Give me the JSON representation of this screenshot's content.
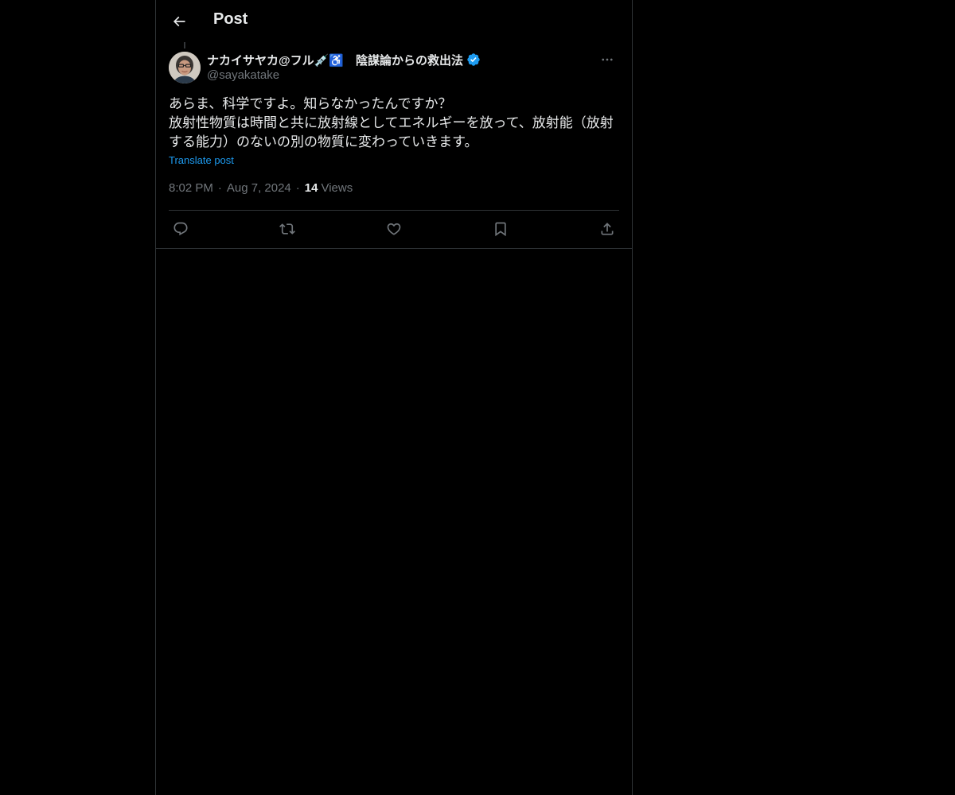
{
  "header": {
    "title": "Post"
  },
  "tweet": {
    "author": {
      "display_name": "ナカイサヤカ@フル💉♿️　陰謀論からの救出法",
      "handle": "@sayakatake",
      "verified": true
    },
    "text": "あらま、科学ですよ。知らなかったんですか？\n放射性物質は時間と共に放射線としてエネルギーを放って、放射能（放射する能力）のないの別の物質に変わっていきます。",
    "translate_label": "Translate post",
    "time": "8:02 PM",
    "date": "Aug 7, 2024",
    "views_count": "14",
    "views_label": "Views",
    "separator": "·"
  },
  "icons": {
    "back": "arrow-left-icon",
    "more": "more-horizontal-icon",
    "reply": "reply-icon",
    "repost": "repost-icon",
    "like": "heart-icon",
    "bookmark": "bookmark-icon",
    "share": "share-icon",
    "verified": "verified-badge-icon"
  },
  "colors": {
    "background": "#000000",
    "text": "#e7e9ea",
    "secondary": "#71767b",
    "accent": "#1d9bf0",
    "border": "#2f3336"
  }
}
